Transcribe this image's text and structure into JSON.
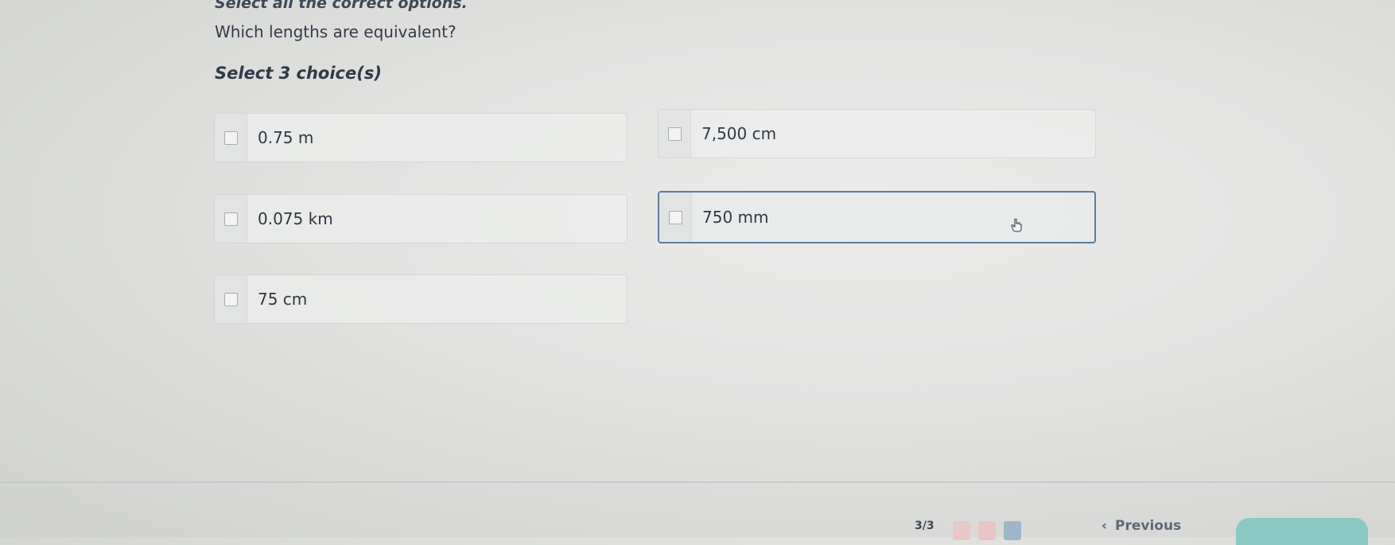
{
  "prompt": {
    "instruction": "Select all the correct options.",
    "question": "Which lengths are equivalent?",
    "choice_count": "Select 3 choice(s)"
  },
  "options": [
    {
      "label": "0.75 m"
    },
    {
      "label": "7,500 cm"
    },
    {
      "label": "0.075 km"
    },
    {
      "label": "750 mm"
    },
    {
      "label": "75 cm"
    }
  ],
  "footer": {
    "progress": "3/3",
    "previous_label": "Previous",
    "next_label": "",
    "nav_dots": [
      "#e8c7c7",
      "#e9c4c4",
      "#9eb6c8"
    ],
    "next_color": "#8bc9c3"
  },
  "icons": {
    "cursor": "pointer-hand-icon",
    "checkbox": "checkbox-icon",
    "previous": "chevron-left-icon"
  }
}
